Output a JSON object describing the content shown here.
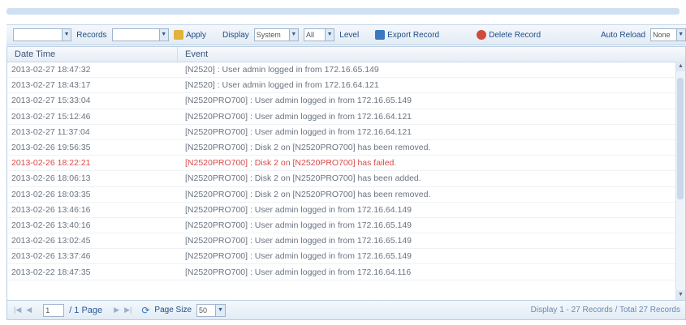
{
  "toolbar": {
    "filter_value": "",
    "records_label": "Records",
    "records_value": "",
    "apply_label": "Apply",
    "display_label": "Display",
    "display_value": "System",
    "level_value": "All",
    "level_label": "Level",
    "export_label": "Export Record",
    "delete_label": "Delete Record",
    "auto_reload_label": "Auto Reload",
    "auto_reload_value": "None"
  },
  "grid": {
    "columns": [
      "Date Time",
      "Event"
    ],
    "rows": [
      {
        "datetime": "2013-02-27 18:47:32",
        "event": "[N2520] : User admin logged in from 172.16.65.149",
        "level": "info"
      },
      {
        "datetime": "2013-02-27 18:43:17",
        "event": "[N2520] : User admin logged in from 172.16.64.121",
        "level": "info"
      },
      {
        "datetime": "2013-02-27 15:33:04",
        "event": "[N2520PRO700] : User admin logged in from 172.16.65.149",
        "level": "info"
      },
      {
        "datetime": "2013-02-27 15:12:46",
        "event": "[N2520PRO700] : User admin logged in from 172.16.64.121",
        "level": "info"
      },
      {
        "datetime": "2013-02-27 11:37:04",
        "event": "[N2520PRO700] : User admin logged in from 172.16.64.121",
        "level": "info"
      },
      {
        "datetime": "2013-02-26 19:56:35",
        "event": "[N2520PRO700] : Disk 2 on [N2520PRO700] has been removed.",
        "level": "info"
      },
      {
        "datetime": "2013-02-26 18:22:21",
        "event": "[N2520PRO700] : Disk 2 on [N2520PRO700] has failed.",
        "level": "error"
      },
      {
        "datetime": "2013-02-26 18:06:13",
        "event": "[N2520PRO700] : Disk 2 on [N2520PRO700] has been added.",
        "level": "info"
      },
      {
        "datetime": "2013-02-26 18:03:35",
        "event": "[N2520PRO700] : Disk 2 on [N2520PRO700] has been removed.",
        "level": "info"
      },
      {
        "datetime": "2013-02-26 13:46:16",
        "event": "[N2520PRO700] : User admin logged in from 172.16.64.149",
        "level": "info"
      },
      {
        "datetime": "2013-02-26 13:40:16",
        "event": "[N2520PRO700] : User admin logged in from 172.16.65.149",
        "level": "info"
      },
      {
        "datetime": "2013-02-26 13:02:45",
        "event": "[N2520PRO700] : User admin logged in from 172.16.65.149",
        "level": "info"
      },
      {
        "datetime": "2013-02-26 13:37:46",
        "event": "[N2520PRO700] : User admin logged in from 172.16.65.149",
        "level": "info"
      },
      {
        "datetime": "2013-02-22 18:47:35",
        "event": "[N2520PRO700] : User admin logged in from 172.16.64.116",
        "level": "info"
      }
    ]
  },
  "pager": {
    "current_page": "1",
    "total_pages_label": "/ 1 Page",
    "page_size_label": "Page Size",
    "page_size_value": "50",
    "display_info": "Display 1 - 27 Records / Total 27 Records"
  },
  "colors": {
    "error_text": "#d94a4a",
    "accent": "#2a5a94"
  }
}
